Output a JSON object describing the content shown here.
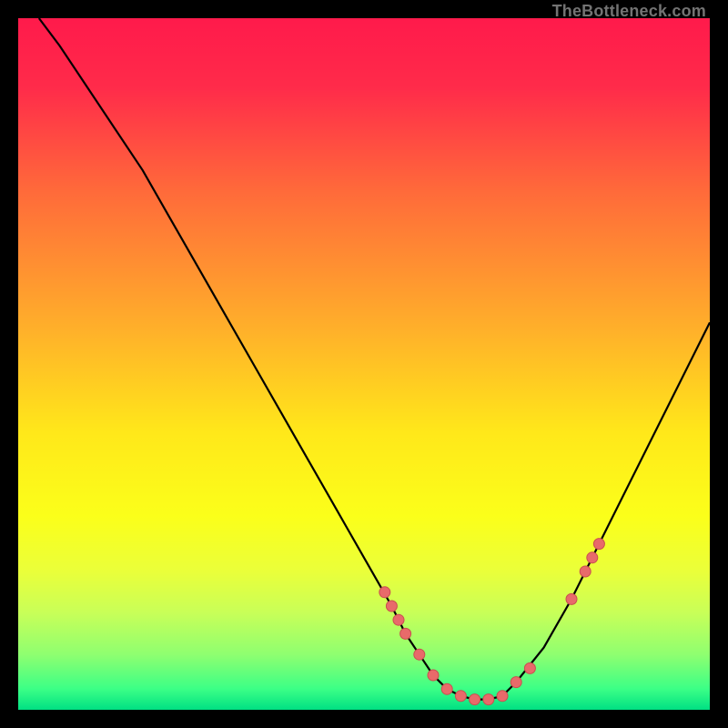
{
  "attribution": "TheBottleneck.com",
  "colors": {
    "gradient_stops": [
      {
        "offset": 0.0,
        "color": "#ff1a4b"
      },
      {
        "offset": 0.1,
        "color": "#ff2b4a"
      },
      {
        "offset": 0.25,
        "color": "#ff6a3a"
      },
      {
        "offset": 0.45,
        "color": "#ffb02a"
      },
      {
        "offset": 0.6,
        "color": "#ffe81a"
      },
      {
        "offset": 0.72,
        "color": "#fbff1a"
      },
      {
        "offset": 0.8,
        "color": "#eaff3a"
      },
      {
        "offset": 0.86,
        "color": "#c8ff58"
      },
      {
        "offset": 0.92,
        "color": "#8fff70"
      },
      {
        "offset": 0.97,
        "color": "#3bff86"
      },
      {
        "offset": 1.0,
        "color": "#00e083"
      }
    ],
    "curve": "#000000",
    "marker_fill": "#e86a6a",
    "marker_stroke": "#c94f4f",
    "frame": "#000000"
  },
  "chart_data": {
    "type": "line",
    "title": "",
    "xlabel": "",
    "ylabel": "",
    "xlim": [
      0,
      100
    ],
    "ylim": [
      0,
      100
    ],
    "grid": false,
    "legend": false,
    "series": [
      {
        "name": "bottleneck-curve",
        "x": [
          3,
          6,
          10,
          14,
          18,
          22,
          26,
          30,
          34,
          38,
          42,
          46,
          50,
          54,
          56,
          58,
          60,
          62,
          64,
          66,
          68,
          70,
          72,
          76,
          80,
          84,
          88,
          92,
          96,
          100
        ],
        "y": [
          100,
          96,
          90,
          84,
          78,
          71,
          64,
          57,
          50,
          43,
          36,
          29,
          22,
          15,
          11,
          8,
          5,
          3,
          2,
          1.5,
          1.5,
          2,
          4,
          9,
          16,
          24,
          32,
          40,
          48,
          56
        ]
      }
    ],
    "markers": {
      "name": "highlight-points",
      "x": [
        53,
        54,
        55,
        56,
        58,
        60,
        62,
        64,
        66,
        68,
        70,
        72,
        74,
        80,
        82,
        83,
        84
      ],
      "y": [
        17,
        15,
        13,
        11,
        8,
        5,
        3,
        2,
        1.5,
        1.5,
        2,
        4,
        6,
        16,
        20,
        22,
        24
      ]
    }
  }
}
